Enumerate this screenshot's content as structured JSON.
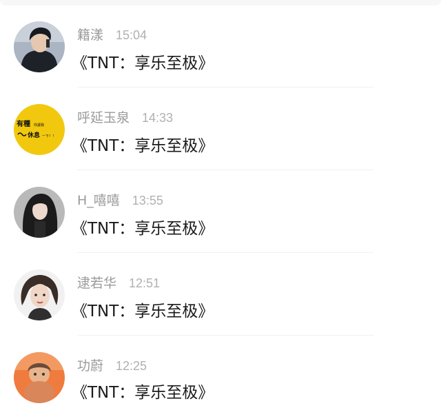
{
  "comments": [
    {
      "name": "籍漾",
      "time": "15:04",
      "text": "《TNT：享乐至极》",
      "avatar": "man-dark-portrait"
    },
    {
      "name": "呼延玉泉",
      "time": "14:33",
      "text": "《TNT：享乐至极》",
      "avatar": "yellow-text-sticker"
    },
    {
      "name": "H_嘻嘻",
      "time": "13:55",
      "text": "《TNT：享乐至极》",
      "avatar": "girl-long-hair"
    },
    {
      "name": "逮若华",
      "time": "12:51",
      "text": "《TNT：享乐至极》",
      "avatar": "girl-bob-illustration"
    },
    {
      "name": "功蔚",
      "time": "12:25",
      "text": "《TNT：享乐至极》",
      "avatar": "cartoon-character-orange"
    }
  ],
  "avatar_sticker": {
    "line1": "有種",
    "line1_small": "你讓我",
    "line2": "休息",
    "line2_small": "一下！！"
  }
}
